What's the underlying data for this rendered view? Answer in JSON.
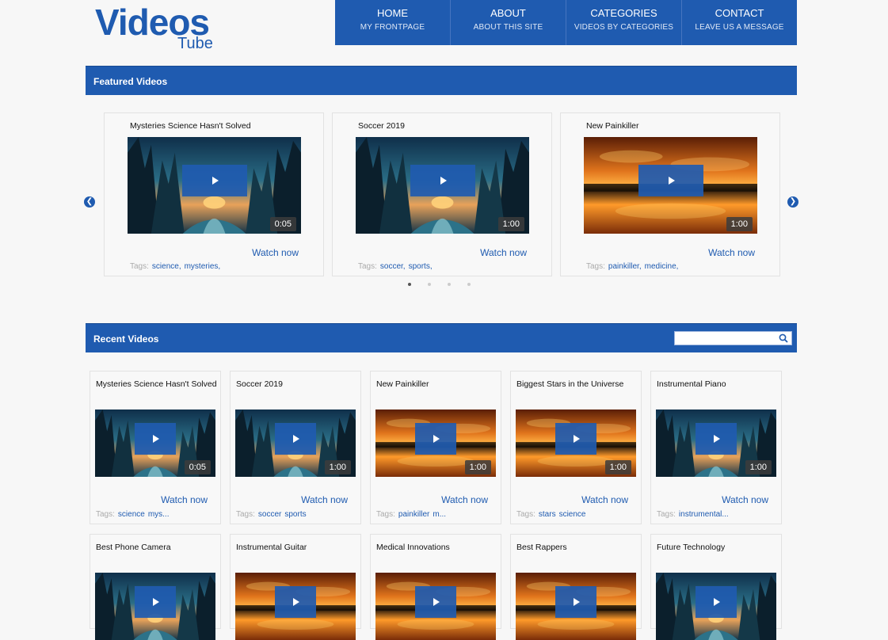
{
  "logo": {
    "main": "Videos",
    "sub": "Tube"
  },
  "nav": [
    {
      "title": "HOME",
      "sub": "MY FRONTPAGE"
    },
    {
      "title": "ABOUT",
      "sub": "ABOUT THIS SITE"
    },
    {
      "title": "CATEGORIES",
      "sub": "VIDEOS BY CATEGORIES"
    },
    {
      "title": "CONTACT",
      "sub": "LEAVE US A MESSAGE"
    }
  ],
  "featured": {
    "heading": "Featured Videos",
    "tags_label": "Tags:",
    "watch_label": "Watch now",
    "items": [
      {
        "title": "Mysteries Science Hasn't Solved",
        "duration": "0:05",
        "thumb": "forest",
        "tags": [
          "science,",
          "mysteries,"
        ]
      },
      {
        "title": "Soccer 2019",
        "duration": "1:00",
        "thumb": "forest",
        "tags": [
          "soccer,",
          "sports,"
        ]
      },
      {
        "title": "New Painkiller",
        "duration": "1:00",
        "thumb": "sunset",
        "tags": [
          "painkiller,",
          "medicine,"
        ]
      }
    ],
    "pager_count": 4,
    "pager_active": 1
  },
  "recent": {
    "heading": "Recent Videos",
    "search_placeholder": "",
    "tags_label": "Tags:",
    "watch_label": "Watch now",
    "items": [
      {
        "title": "Mysteries Science Hasn't Solved",
        "duration": "0:05",
        "thumb": "forest",
        "tags": [
          "science",
          "mys..."
        ]
      },
      {
        "title": "Soccer 2019",
        "duration": "1:00",
        "thumb": "forest",
        "tags": [
          "soccer",
          "sports"
        ]
      },
      {
        "title": "New Painkiller",
        "duration": "1:00",
        "thumb": "sunset",
        "tags": [
          "painkiller",
          "m..."
        ]
      },
      {
        "title": "Biggest Stars in the Universe",
        "duration": "1:00",
        "thumb": "sunset",
        "tags": [
          "stars",
          "science"
        ]
      },
      {
        "title": "Instrumental Piano",
        "duration": "1:00",
        "thumb": "forest",
        "tags": [
          "instrumental..."
        ]
      },
      {
        "title": "Best Phone Camera",
        "duration": "",
        "thumb": "forest",
        "tags": []
      },
      {
        "title": "Instrumental Guitar",
        "duration": "",
        "thumb": "sunset",
        "tags": []
      },
      {
        "title": "Medical Innovations",
        "duration": "",
        "thumb": "sunset",
        "tags": []
      },
      {
        "title": "Best Rappers",
        "duration": "",
        "thumb": "sunset",
        "tags": []
      },
      {
        "title": "Future Technology",
        "duration": "",
        "thumb": "forest",
        "tags": []
      }
    ]
  },
  "colors": {
    "brand": "#1f5bb0",
    "background": "#f7f7f7"
  },
  "icons": {
    "prev": "chevron-left-icon",
    "next": "chevron-right-icon",
    "search": "search-icon",
    "play": "play-icon"
  }
}
